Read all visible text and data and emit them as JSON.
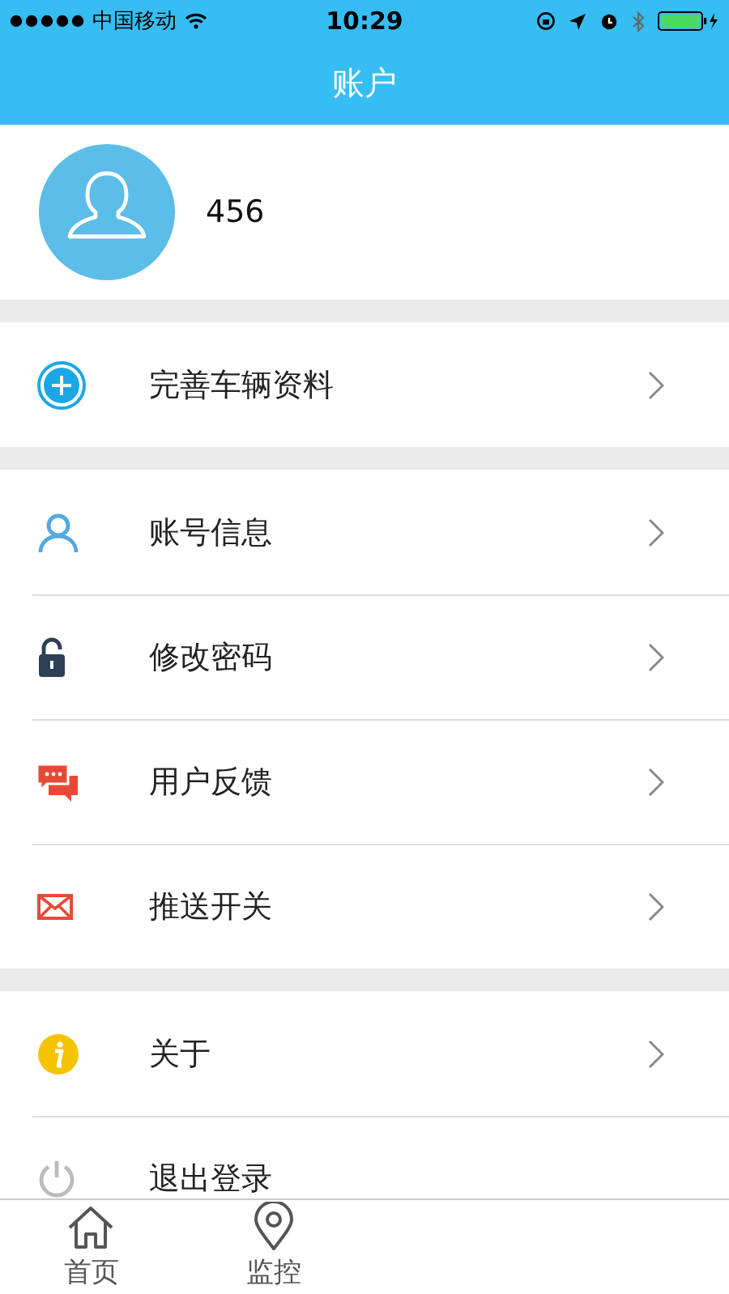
{
  "status_bar": {
    "carrier": "中国移动",
    "time": "10:29"
  },
  "nav": {
    "title": "账户"
  },
  "profile": {
    "name": "456"
  },
  "sections": [
    [
      {
        "label": "完善车辆资料",
        "kind": "plus"
      }
    ],
    [
      {
        "label": "账号信息",
        "kind": "user"
      },
      {
        "label": "修改密码",
        "kind": "lock"
      },
      {
        "label": "用户反馈",
        "kind": "chat"
      },
      {
        "label": "推送开关",
        "kind": "mail"
      }
    ],
    [
      {
        "label": "关于",
        "kind": "info"
      },
      {
        "label": "退出登录",
        "kind": "power"
      }
    ]
  ],
  "tab_bar": [
    {
      "label": "首页",
      "kind": "home"
    },
    {
      "label": "监控",
      "kind": "pin"
    }
  ]
}
